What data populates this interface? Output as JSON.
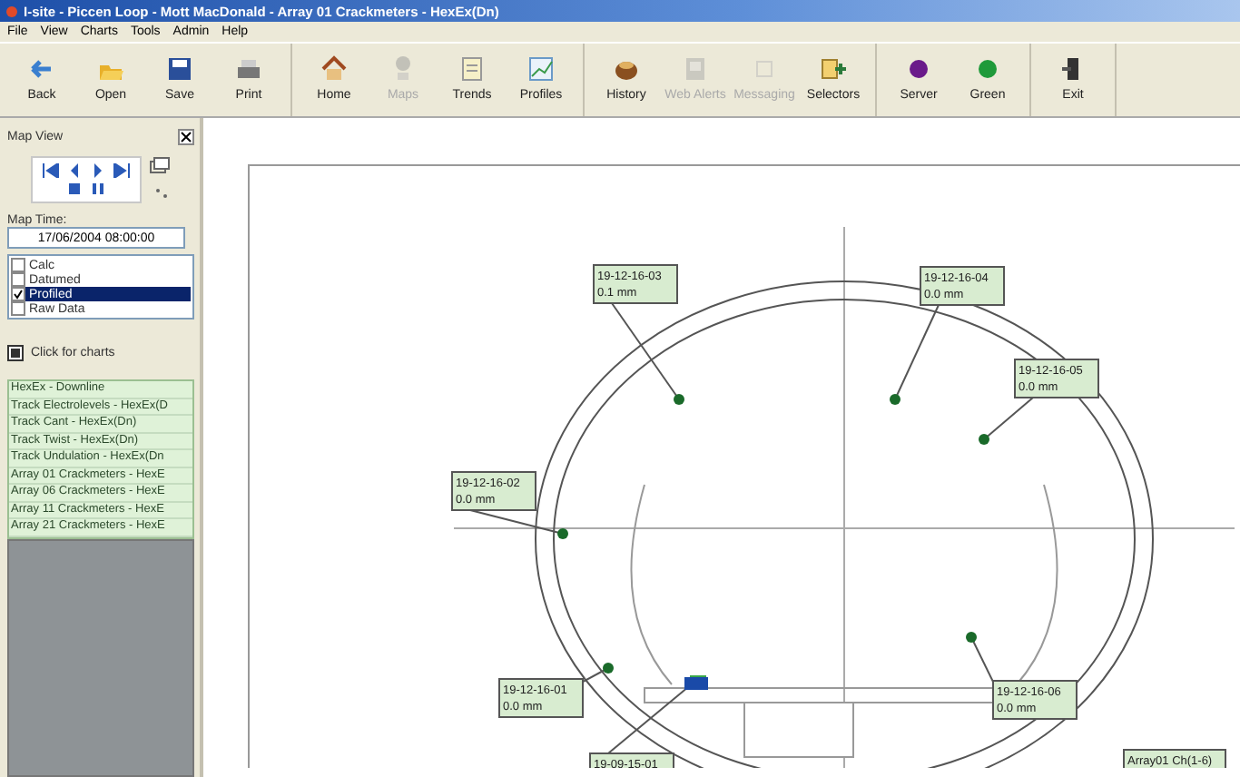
{
  "window": {
    "title": "I-site - Piccen Loop - Mott MacDonald - Array 01 Crackmeters - HexEx(Dn)"
  },
  "menu": [
    "File",
    "View",
    "Charts",
    "Tools",
    "Admin",
    "Help"
  ],
  "toolbar": [
    [
      {
        "label": "Back",
        "disabled": false
      },
      {
        "label": "Open",
        "disabled": false
      },
      {
        "label": "Save",
        "disabled": false
      },
      {
        "label": "Print",
        "disabled": false
      }
    ],
    [
      {
        "label": "Home",
        "disabled": false
      },
      {
        "label": "Maps",
        "disabled": true
      },
      {
        "label": "Trends",
        "disabled": false
      },
      {
        "label": "Profiles",
        "disabled": false
      }
    ],
    [
      {
        "label": "History",
        "disabled": false
      },
      {
        "label": "Web Alerts",
        "disabled": true
      },
      {
        "label": "Messaging",
        "disabled": true
      },
      {
        "label": "Selectors",
        "disabled": false
      }
    ],
    [
      {
        "label": "Server",
        "color": "#6a1a8a",
        "disabled": false
      },
      {
        "label": "Green",
        "color": "#1f9a3a",
        "disabled": false
      }
    ],
    [
      {
        "label": "Exit",
        "disabled": false
      }
    ]
  ],
  "panel": {
    "title": "Map View",
    "map_time_label": "Map Time:",
    "map_time": "17/06/2004 08:00:00",
    "options": [
      {
        "label": "Calc",
        "checked": false,
        "selected": false
      },
      {
        "label": "Datumed",
        "checked": false,
        "selected": false
      },
      {
        "label": "Profiled",
        "checked": true,
        "selected": true
      },
      {
        "label": "Raw Data",
        "checked": false,
        "selected": false
      }
    ],
    "charts_toggle": {
      "label": "Click for charts",
      "checked": true
    },
    "charts": [
      "HexEx - Downline",
      "Track Electrolevels - HexEx(D",
      "Track Cant - HexEx(Dn)",
      "Track Twist - HexEx(Dn)",
      "Track Undulation - HexEx(Dn",
      "Array 01 Crackmeters - HexE",
      "Array 06 Crackmeters - HexE",
      "Array 11 Crackmeters - HexE",
      "Array 21 Crackmeters - HexE"
    ]
  },
  "sensors": [
    {
      "id": "19-12-16-03",
      "reading": "0.1 mm"
    },
    {
      "id": "19-12-16-04",
      "reading": "0.0 mm"
    },
    {
      "id": "19-12-16-05",
      "reading": "0.0 mm"
    },
    {
      "id": "19-12-16-02",
      "reading": "0.0 mm"
    },
    {
      "id": "19-12-16-01",
      "reading": "0.0 mm"
    },
    {
      "id": "19-12-16-06",
      "reading": "0.0 mm"
    },
    {
      "id": "19-09-15-01"
    }
  ],
  "legend": "Array01 Ch(1-6)"
}
